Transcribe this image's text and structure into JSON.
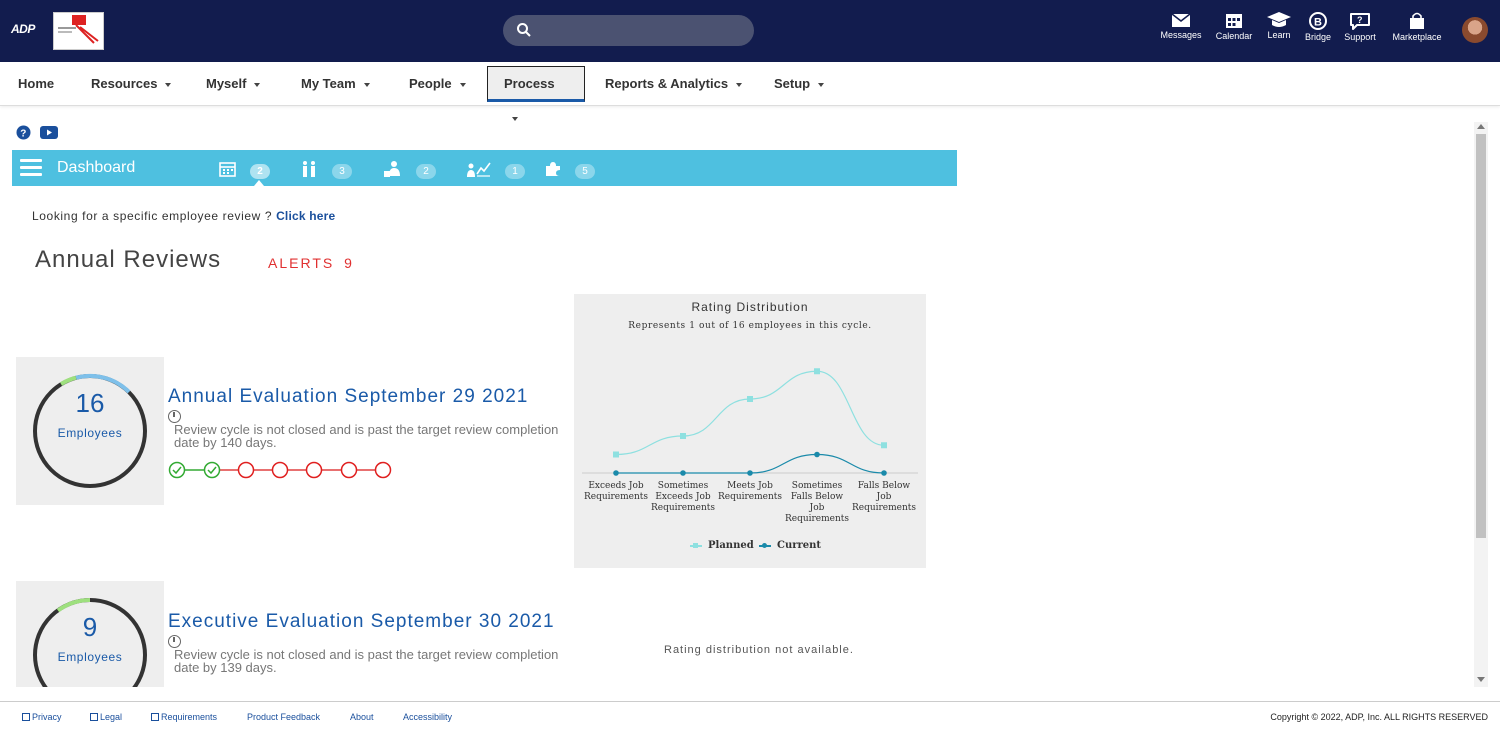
{
  "topbar": {
    "logo_text": "ADP",
    "search_placeholder": "",
    "icons": [
      {
        "label": "Messages",
        "icon": "envelope-icon"
      },
      {
        "label": "Calendar",
        "icon": "calendar-icon"
      },
      {
        "label": "Learn",
        "icon": "graduation-cap-icon"
      },
      {
        "label": "Bridge",
        "icon": "bridge-icon"
      },
      {
        "label": "Support",
        "icon": "speech-bubble-icon"
      },
      {
        "label": "Marketplace",
        "icon": "shopping-bag-icon"
      }
    ]
  },
  "nav": {
    "items": [
      {
        "label": "Home",
        "caret": false
      },
      {
        "label": "Resources",
        "caret": true
      },
      {
        "label": "Myself",
        "caret": true
      },
      {
        "label": "My Team",
        "caret": true
      },
      {
        "label": "People",
        "caret": true
      },
      {
        "label": "Process",
        "caret": true,
        "active": true
      },
      {
        "label": "Reports & Analytics",
        "caret": true
      },
      {
        "label": "Setup",
        "caret": true
      }
    ]
  },
  "dashboard": {
    "title": "Dashboard",
    "tabs": [
      {
        "icon": "calendar-icon",
        "count": "2"
      },
      {
        "icon": "people-icon",
        "count": "3"
      },
      {
        "icon": "person-puzzle-icon",
        "count": "2"
      },
      {
        "icon": "growth-chart-icon",
        "count": "1"
      },
      {
        "icon": "puzzle-icon",
        "count": "5"
      }
    ]
  },
  "lookup": {
    "text": "Looking for a specific employee review ?",
    "link": "Click here"
  },
  "page": {
    "title": "Annual Reviews",
    "alerts_label": "ALERTS",
    "alerts_count": "9"
  },
  "reviews": [
    {
      "count": "16",
      "count_label": "Employees",
      "title": "Annual Evaluation September 29 2021",
      "desc_line1": "Review cycle is not closed and is past the target review completion",
      "desc_line2": "date by 140 days.",
      "progress_fraction": 0.18,
      "steps_done": 2,
      "steps_total": 7
    },
    {
      "count": "9",
      "count_label": "Employees",
      "title": "Executive Evaluation September 30 2021",
      "desc_line1": "Review cycle is not closed and is past the target review completion",
      "desc_line2": "date by 139 days.",
      "progress_fraction": 0.12
    }
  ],
  "chart_data": {
    "type": "line",
    "title": "Rating Distribution",
    "subtitle": "Represents 1 out of 16 employees in this cycle.",
    "categories": [
      [
        "Exceeds Job",
        "Requirements"
      ],
      [
        "Sometimes",
        "Exceeds Job",
        "Requirements"
      ],
      [
        "Meets Job",
        "Requirements"
      ],
      [
        "Sometimes",
        "Falls Below",
        "Job",
        "Requirements"
      ],
      [
        "Falls Below",
        "Job",
        "Requirements"
      ]
    ],
    "series": [
      {
        "name": "Planned",
        "values": [
          10,
          20,
          40,
          55,
          15
        ],
        "color": "#8ee0e0"
      },
      {
        "name": "Current",
        "values": [
          0,
          0,
          0,
          10,
          0
        ],
        "color": "#1a8aaa"
      }
    ],
    "ylim": [
      0,
      60
    ],
    "legend_position": "bottom"
  },
  "chart2": {
    "message": "Rating distribution not available."
  },
  "footer": {
    "links": [
      "Privacy",
      "Legal",
      "Requirements",
      "Product Feedback",
      "About",
      "Accessibility"
    ],
    "copyright": "Copyright © 2022, ADP, Inc. ALL RIGHTS RESERVED"
  }
}
